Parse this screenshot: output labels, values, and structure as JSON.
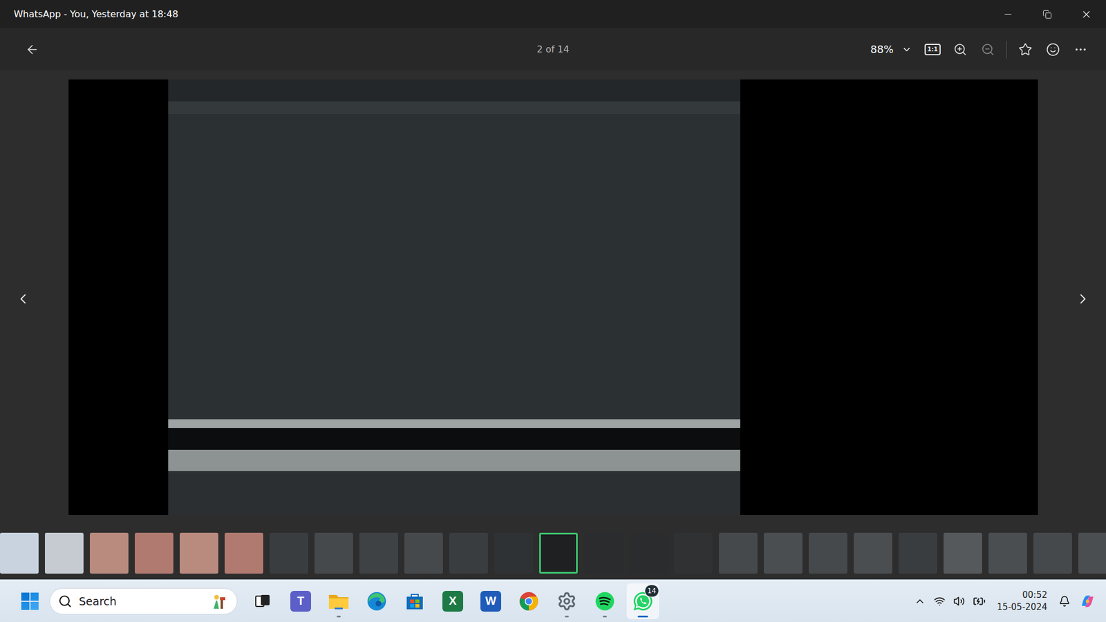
{
  "window": {
    "title": "WhatsApp - You, Yesterday at 18:48"
  },
  "viewer": {
    "counter": "2 of 14",
    "zoom": "88%",
    "actual_size": "1:1",
    "favorite": false
  },
  "thumbnails": [
    {
      "selected": false,
      "color": "#c9d3e0"
    },
    {
      "selected": false,
      "color": "#c6cbd2"
    },
    {
      "selected": false,
      "color": "#b98a7e"
    },
    {
      "selected": false,
      "color": "#b07a70"
    },
    {
      "selected": false,
      "color": "#b98a7e"
    },
    {
      "selected": false,
      "color": "#b07a70"
    },
    {
      "selected": false,
      "color": "#3a3d40"
    },
    {
      "selected": false,
      "color": "#45494c"
    },
    {
      "selected": false,
      "color": "#3e4245"
    },
    {
      "selected": false,
      "color": "#45494c"
    },
    {
      "selected": false,
      "color": "#3a3d40"
    },
    {
      "selected": false,
      "color": "#2f3235"
    },
    {
      "selected": true,
      "color": "#1e2022"
    },
    {
      "selected": false,
      "color": "#2a2c2e"
    },
    {
      "selected": false,
      "color": "#2a2c2e"
    },
    {
      "selected": false,
      "color": "#2f3133"
    },
    {
      "selected": false,
      "color": "#45494c"
    },
    {
      "selected": false,
      "color": "#4a4e51"
    },
    {
      "selected": false,
      "color": "#45494c"
    },
    {
      "selected": false,
      "color": "#4a4e51"
    },
    {
      "selected": false,
      "color": "#3a3d40"
    },
    {
      "selected": false,
      "color": "#55595c"
    },
    {
      "selected": false,
      "color": "#4a4e51"
    },
    {
      "selected": false,
      "color": "#45494c"
    },
    {
      "selected": false,
      "color": "#4a4e51"
    }
  ],
  "taskbar": {
    "search": {
      "placeholder": "Search"
    },
    "apps": [
      {
        "name": "Task View",
        "kind": "taskview",
        "running": false,
        "active": false
      },
      {
        "name": "Teams",
        "kind": "teams",
        "glyph": "T",
        "running": false,
        "active": false
      },
      {
        "name": "File Explorer",
        "kind": "explorer",
        "running": true,
        "active": false
      },
      {
        "name": "Edge",
        "kind": "edge",
        "running": false,
        "active": false
      },
      {
        "name": "Store",
        "kind": "store",
        "running": false,
        "active": false
      },
      {
        "name": "Excel",
        "kind": "excel",
        "glyph": "X",
        "running": false,
        "active": false
      },
      {
        "name": "Word",
        "kind": "word",
        "glyph": "W",
        "running": false,
        "active": false
      },
      {
        "name": "Chrome",
        "kind": "chrome",
        "running": false,
        "active": false
      },
      {
        "name": "Settings",
        "kind": "settings",
        "running": true,
        "active": false
      },
      {
        "name": "Spotify",
        "kind": "spotify",
        "running": true,
        "active": false
      },
      {
        "name": "WhatsApp",
        "kind": "whatsapp",
        "badge": "14",
        "running": true,
        "active": true
      }
    ],
    "clock": {
      "time": "00:52",
      "date": "15-05-2024"
    }
  }
}
